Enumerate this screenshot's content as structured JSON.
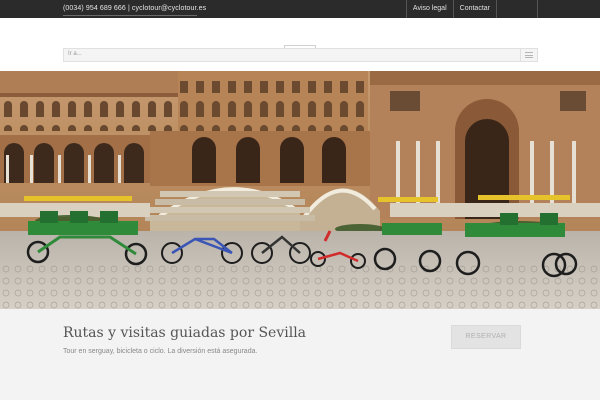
{
  "topbar": {
    "contact": "(0034) 954 689 666 | cyclotour@cyclotour.es",
    "links": [
      "Aviso legal",
      "Contactar"
    ]
  },
  "header": {
    "logo_icon": "logo-icon"
  },
  "nav": {
    "text": "Ir a...",
    "menu_icon": "hamburger-menu-icon"
  },
  "hero": {
    "alt": "Plaza de España, Sevilla, with bicycles and quadricycles lined up"
  },
  "cta": {
    "title": "Rutas y visitas guiadas por Sevilla",
    "subtitle": "Tour en serguay, bicicleta o ciclo. La diversión está asegurada.",
    "button": "RESERVAR"
  },
  "colors": {
    "topbar_bg": "#2b2b2b",
    "brick": "#b98a5c",
    "quad_green": "#2f8a3a",
    "canopy_yellow": "#e6c22b",
    "footer_bg": "#f3f3f3"
  }
}
